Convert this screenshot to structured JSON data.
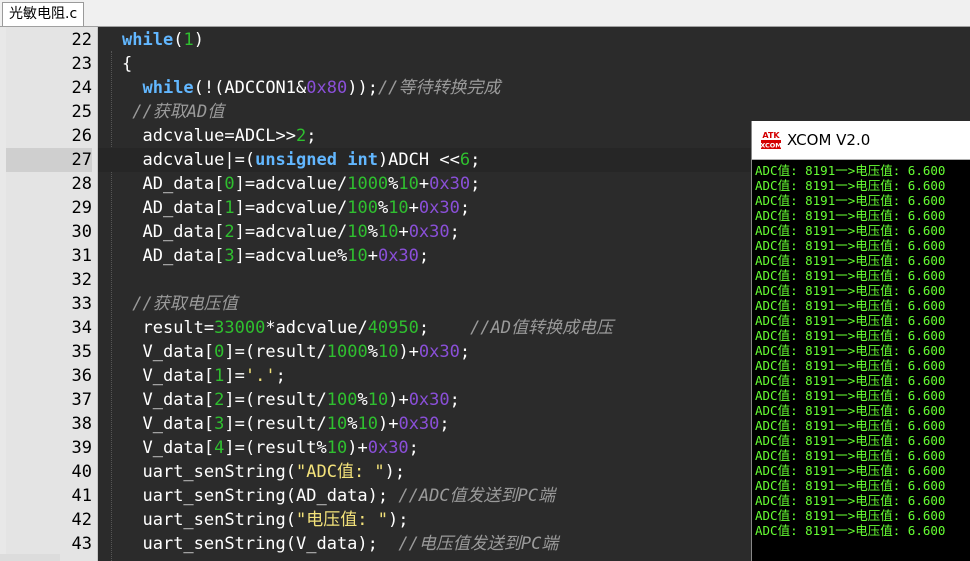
{
  "tab": {
    "title": "光敏电阻.c"
  },
  "current_line": "27",
  "lines": [
    {
      "no": "22",
      "indent": "",
      "tokens": [
        {
          "t": "while",
          "c": "kw"
        },
        {
          "t": "(",
          "c": ""
        },
        {
          "t": "1",
          "c": "num"
        },
        {
          "t": ")",
          "c": ""
        }
      ]
    },
    {
      "no": "23",
      "indent": "",
      "tokens": [
        {
          "t": "{",
          "c": ""
        }
      ]
    },
    {
      "no": "24",
      "indent": "  ",
      "tokens": [
        {
          "t": "while",
          "c": "kw"
        },
        {
          "t": "(!(ADCCON1&",
          "c": ""
        },
        {
          "t": "0x80",
          "c": "hex"
        },
        {
          "t": "));",
          "c": ""
        },
        {
          "t": "//等待转换完成",
          "c": "cm"
        }
      ]
    },
    {
      "no": "25",
      "indent": " ",
      "tokens": [
        {
          "t": "//获取AD值",
          "c": "cm"
        }
      ]
    },
    {
      "no": "26",
      "indent": "  ",
      "tokens": [
        {
          "t": "adcvalue=ADCL>>",
          "c": ""
        },
        {
          "t": "2",
          "c": "num"
        },
        {
          "t": ";",
          "c": ""
        }
      ]
    },
    {
      "no": "27",
      "indent": "  ",
      "tokens": [
        {
          "t": "adcvalue|=(",
          "c": ""
        },
        {
          "t": "unsigned",
          "c": "kw"
        },
        {
          "t": " ",
          "c": ""
        },
        {
          "t": "int",
          "c": "kw"
        },
        {
          "t": ")ADCH <<",
          "c": ""
        },
        {
          "t": "6",
          "c": "num"
        },
        {
          "t": ";",
          "c": ""
        }
      ]
    },
    {
      "no": "28",
      "indent": "  ",
      "tokens": [
        {
          "t": "AD_data[",
          "c": ""
        },
        {
          "t": "0",
          "c": "num"
        },
        {
          "t": "]=adcvalue/",
          "c": ""
        },
        {
          "t": "1000",
          "c": "num"
        },
        {
          "t": "%",
          "c": ""
        },
        {
          "t": "10",
          "c": "num"
        },
        {
          "t": "+",
          "c": ""
        },
        {
          "t": "0x30",
          "c": "hex"
        },
        {
          "t": ";",
          "c": ""
        }
      ]
    },
    {
      "no": "29",
      "indent": "  ",
      "tokens": [
        {
          "t": "AD_data[",
          "c": ""
        },
        {
          "t": "1",
          "c": "num"
        },
        {
          "t": "]=adcvalue/",
          "c": ""
        },
        {
          "t": "100",
          "c": "num"
        },
        {
          "t": "%",
          "c": ""
        },
        {
          "t": "10",
          "c": "num"
        },
        {
          "t": "+",
          "c": ""
        },
        {
          "t": "0x30",
          "c": "hex"
        },
        {
          "t": ";",
          "c": ""
        }
      ]
    },
    {
      "no": "30",
      "indent": "  ",
      "tokens": [
        {
          "t": "AD_data[",
          "c": ""
        },
        {
          "t": "2",
          "c": "num"
        },
        {
          "t": "]=adcvalue/",
          "c": ""
        },
        {
          "t": "10",
          "c": "num"
        },
        {
          "t": "%",
          "c": ""
        },
        {
          "t": "10",
          "c": "num"
        },
        {
          "t": "+",
          "c": ""
        },
        {
          "t": "0x30",
          "c": "hex"
        },
        {
          "t": ";",
          "c": ""
        }
      ]
    },
    {
      "no": "31",
      "indent": "  ",
      "tokens": [
        {
          "t": "AD_data[",
          "c": ""
        },
        {
          "t": "3",
          "c": "num"
        },
        {
          "t": "]=adcvalue%",
          "c": ""
        },
        {
          "t": "10",
          "c": "num"
        },
        {
          "t": "+",
          "c": ""
        },
        {
          "t": "0x30",
          "c": "hex"
        },
        {
          "t": ";",
          "c": ""
        }
      ]
    },
    {
      "no": "32",
      "indent": "",
      "tokens": []
    },
    {
      "no": "33",
      "indent": " ",
      "tokens": [
        {
          "t": "//获取电压值",
          "c": "cm"
        }
      ]
    },
    {
      "no": "34",
      "indent": "  ",
      "tokens": [
        {
          "t": "result=",
          "c": ""
        },
        {
          "t": "33000",
          "c": "num"
        },
        {
          "t": "*adcvalue/",
          "c": ""
        },
        {
          "t": "40950",
          "c": "num"
        },
        {
          "t": ";    ",
          "c": ""
        },
        {
          "t": "//AD值转换成电压",
          "c": "cm"
        }
      ]
    },
    {
      "no": "35",
      "indent": "  ",
      "tokens": [
        {
          "t": "V_data[",
          "c": ""
        },
        {
          "t": "0",
          "c": "num"
        },
        {
          "t": "]=(result/",
          "c": ""
        },
        {
          "t": "1000",
          "c": "num"
        },
        {
          "t": "%",
          "c": ""
        },
        {
          "t": "10",
          "c": "num"
        },
        {
          "t": ")+",
          "c": ""
        },
        {
          "t": "0x30",
          "c": "hex"
        },
        {
          "t": ";",
          "c": ""
        }
      ]
    },
    {
      "no": "36",
      "indent": "  ",
      "tokens": [
        {
          "t": "V_data[",
          "c": ""
        },
        {
          "t": "1",
          "c": "num"
        },
        {
          "t": "]=",
          "c": ""
        },
        {
          "t": "'.'",
          "c": "str"
        },
        {
          "t": ";",
          "c": ""
        }
      ]
    },
    {
      "no": "37",
      "indent": "  ",
      "tokens": [
        {
          "t": "V_data[",
          "c": ""
        },
        {
          "t": "2",
          "c": "num"
        },
        {
          "t": "]=(result/",
          "c": ""
        },
        {
          "t": "100",
          "c": "num"
        },
        {
          "t": "%",
          "c": ""
        },
        {
          "t": "10",
          "c": "num"
        },
        {
          "t": ")+",
          "c": ""
        },
        {
          "t": "0x30",
          "c": "hex"
        },
        {
          "t": ";",
          "c": ""
        }
      ]
    },
    {
      "no": "38",
      "indent": "  ",
      "tokens": [
        {
          "t": "V_data[",
          "c": ""
        },
        {
          "t": "3",
          "c": "num"
        },
        {
          "t": "]=(result/",
          "c": ""
        },
        {
          "t": "10",
          "c": "num"
        },
        {
          "t": "%",
          "c": ""
        },
        {
          "t": "10",
          "c": "num"
        },
        {
          "t": ")+",
          "c": ""
        },
        {
          "t": "0x30",
          "c": "hex"
        },
        {
          "t": ";",
          "c": ""
        }
      ]
    },
    {
      "no": "39",
      "indent": "  ",
      "tokens": [
        {
          "t": "V_data[",
          "c": ""
        },
        {
          "t": "4",
          "c": "num"
        },
        {
          "t": "]=(result%",
          "c": ""
        },
        {
          "t": "10",
          "c": "num"
        },
        {
          "t": ")+",
          "c": ""
        },
        {
          "t": "0x30",
          "c": "hex"
        },
        {
          "t": ";",
          "c": ""
        }
      ]
    },
    {
      "no": "40",
      "indent": "  ",
      "tokens": [
        {
          "t": "uart_senString(",
          "c": ""
        },
        {
          "t": "\"ADC值: \"",
          "c": "str"
        },
        {
          "t": ");",
          "c": ""
        }
      ]
    },
    {
      "no": "41",
      "indent": "  ",
      "tokens": [
        {
          "t": "uart_senString(AD_data); ",
          "c": ""
        },
        {
          "t": "//ADC值发送到PC端",
          "c": "cm"
        }
      ]
    },
    {
      "no": "42",
      "indent": "  ",
      "tokens": [
        {
          "t": "uart_senString(",
          "c": ""
        },
        {
          "t": "\"电压值: \"",
          "c": "str"
        },
        {
          "t": ");",
          "c": ""
        }
      ]
    },
    {
      "no": "43",
      "indent": "  ",
      "tokens": [
        {
          "t": "uart_senString(V_data);  ",
          "c": ""
        },
        {
          "t": "//电压值发送到PC端",
          "c": "cm"
        }
      ]
    }
  ],
  "xcom": {
    "logo_top": "ATK",
    "logo_bottom": "XCOM",
    "title": "XCOM V2.0",
    "output": [
      "ADC值: 8191一>电压值: 6.600",
      "ADC值: 8191一>电压值: 6.600",
      "ADC值: 8191一>电压值: 6.600",
      "ADC值: 8191一>电压值: 6.600",
      "ADC值: 8191一>电压值: 6.600",
      "ADC值: 8191一>电压值: 6.600",
      "ADC值: 8191一>电压值: 6.600",
      "ADC值: 8191一>电压值: 6.600",
      "ADC值: 8191一>电压值: 6.600",
      "ADC值: 8191一>电压值: 6.600",
      "ADC值: 8191一>电压值: 6.600",
      "ADC值: 8191一>电压值: 6.600",
      "ADC值: 8191一>电压值: 6.600",
      "ADC值: 8191一>电压值: 6.600",
      "ADC值: 8191一>电压值: 6.600",
      "ADC值: 8191一>电压值: 6.600",
      "ADC值: 8191一>电压值: 6.600",
      "ADC值: 8191一>电压值: 6.600",
      "ADC值: 8191一>电压值: 6.600",
      "ADC值: 8191一>电压值: 6.600",
      "ADC值: 8191一>电压值: 6.600",
      "ADC值: 8191一>电压值: 6.600",
      "ADC值: 8191一>电压值: 6.600",
      "ADC值: 8191一>电压值: 6.600",
      "ADC值: 8191一>电压值: 6.600"
    ]
  }
}
